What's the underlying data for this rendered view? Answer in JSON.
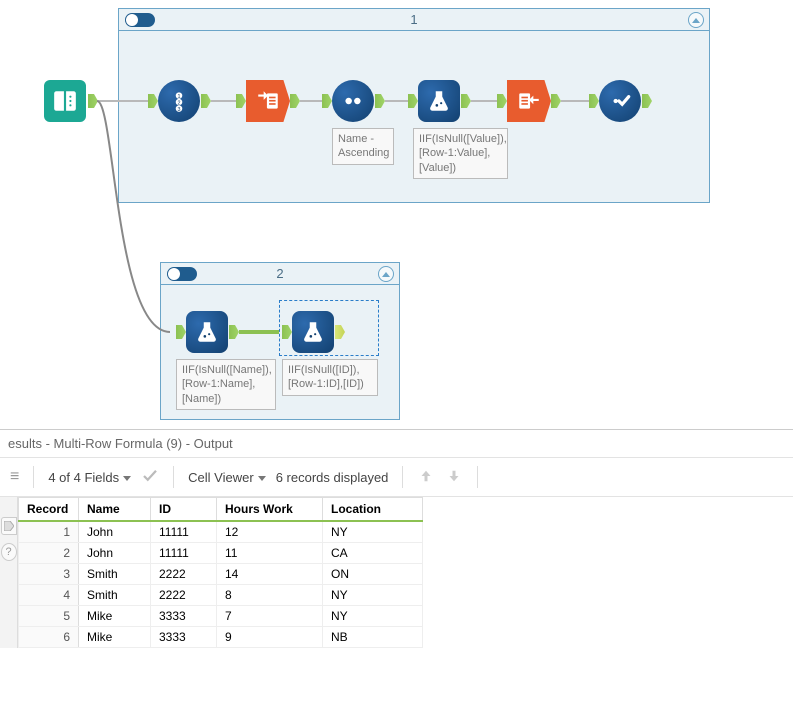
{
  "containers": {
    "c1": {
      "title": "1"
    },
    "c2": {
      "title": "2"
    }
  },
  "annotations": {
    "sort": "Name - Ascending",
    "mrf_value": "IIF(IsNull([Value]),[Row-1:Value],[Value])",
    "mrf_name": "IIF(IsNull([Name]),[Row-1:Name],[Name])",
    "mrf_id": "IIF(IsNull([ID]),[Row-1:ID],[ID])"
  },
  "results": {
    "title": "esults - Multi-Row Formula (9) - Output",
    "fields_summary": "4 of 4 Fields",
    "cell_viewer_label": "Cell Viewer",
    "records_summary": "6 records displayed",
    "columns": [
      "Record",
      "Name",
      "ID",
      "Hours Work",
      "Location"
    ],
    "rows": [
      {
        "rec": "1",
        "name": "John",
        "id": "11111",
        "hw": "12",
        "loc": "NY"
      },
      {
        "rec": "2",
        "name": "John",
        "id": "11111",
        "hw": "11",
        "loc": "CA"
      },
      {
        "rec": "3",
        "name": "Smith",
        "id": "2222",
        "hw": "14",
        "loc": "ON"
      },
      {
        "rec": "4",
        "name": "Smith",
        "id": "2222",
        "hw": "8",
        "loc": "NY"
      },
      {
        "rec": "5",
        "name": "Mike",
        "id": "3333",
        "hw": "7",
        "loc": "NY"
      },
      {
        "rec": "6",
        "name": "Mike",
        "id": "3333",
        "hw": "9",
        "loc": "NB"
      }
    ]
  }
}
